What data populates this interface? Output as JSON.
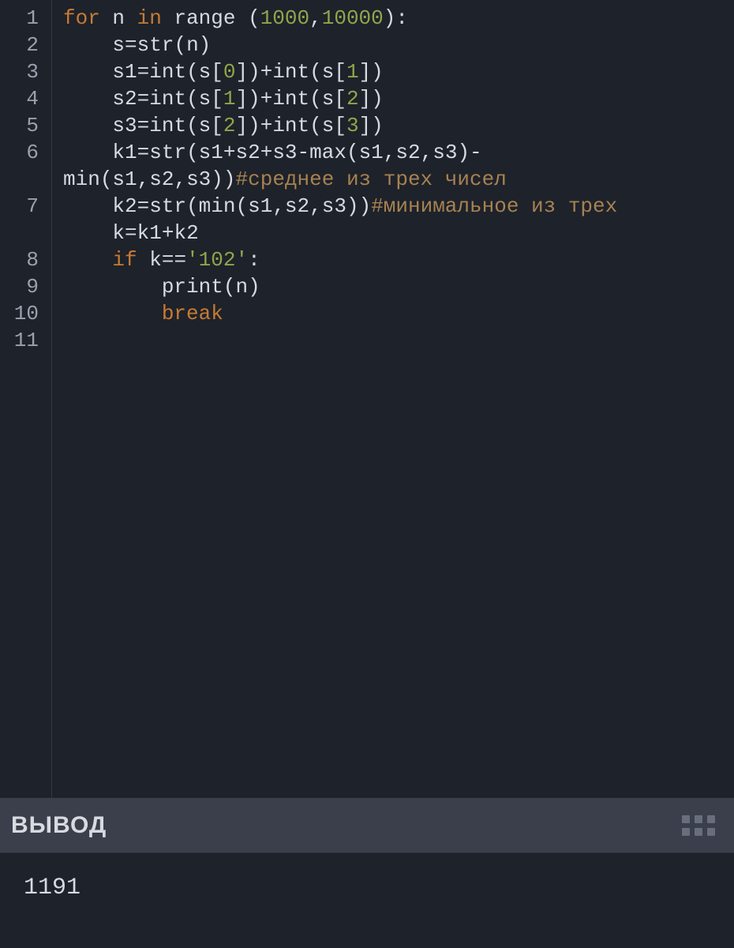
{
  "editor": {
    "line_numbers": [
      "1",
      "2",
      "3",
      "4",
      "5",
      "6",
      "",
      "7",
      "",
      "8",
      "9",
      "10",
      "11"
    ],
    "code": {
      "l1": {
        "for": "for",
        "n": "n",
        "in": "in",
        "range": "range",
        "a": "1000",
        "b": "10000"
      },
      "l2": {
        "s": "s",
        "str": "str",
        "n": "n"
      },
      "l3": {
        "s1": "s1",
        "int": "int",
        "s": "s",
        "i0": "0",
        "i1": "1"
      },
      "l4": {
        "s2": "s2",
        "int": "int",
        "s": "s",
        "i1": "1",
        "i2": "2"
      },
      "l5": {
        "s3": "s3",
        "int": "int",
        "s": "s",
        "i2": "2",
        "i3": "3"
      },
      "l6": {
        "k1": "k1",
        "str": "str",
        "s1": "s1",
        "s2": "s2",
        "s3": "s3",
        "max": "max",
        "min": "min",
        "cmt": "#среднее из трех чисел"
      },
      "l7": {
        "k2": "k2",
        "str": "str",
        "min": "min",
        "s1": "s1",
        "s2": "s2",
        "s3": "s3",
        "cmt": "#минимальное из трех"
      },
      "l8": {
        "k": "k",
        "k1": "k1",
        "k2": "k2"
      },
      "l9": {
        "if": "if",
        "k": "k",
        "val": "'102'"
      },
      "l10": {
        "print": "print",
        "n": "n"
      },
      "l11": {
        "break": "break"
      }
    }
  },
  "output": {
    "title": "ВЫВОД",
    "text": "1191"
  }
}
